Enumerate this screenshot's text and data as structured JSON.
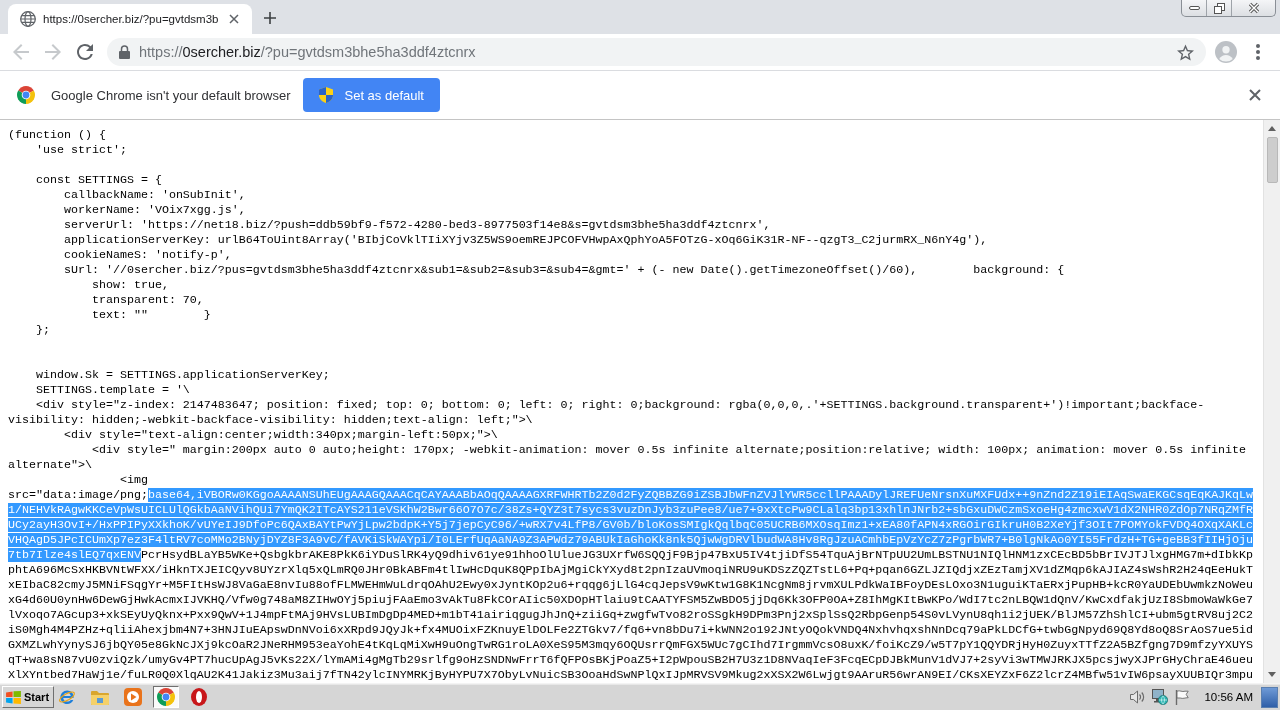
{
  "browser": {
    "tabs": [
      {
        "title": "https://0sercher.biz/?pu=gvtdsm3b",
        "selected": true
      }
    ],
    "nav_buttons": [
      {
        "kind": "back",
        "disabled": true
      },
      {
        "kind": "forward",
        "disabled": true
      },
      {
        "kind": "reload",
        "disabled": false
      }
    ],
    "address_bar": {
      "url": [
        {
          "text": "https://",
          "emphasized": false
        },
        {
          "text": "0sercher.biz",
          "emphasized": true
        },
        {
          "text": "/?pu=gvtdsm3bhe5ha3ddf4ztcnrx",
          "emphasized": false
        }
      ]
    },
    "infobar": {
      "message": "Google Chrome isn't your default browser",
      "button": "Set as default"
    }
  },
  "page": {
    "lines": [
      {
        "kind": "code",
        "segments": [
          {
            "text": "(function () {",
            "selected": false
          }
        ]
      },
      {
        "kind": "code",
        "segments": [
          {
            "text": "    'use strict';",
            "selected": false
          }
        ]
      },
      {
        "kind": "blank"
      },
      {
        "kind": "code",
        "segments": [
          {
            "text": "    const SETTINGS = {",
            "selected": false
          }
        ]
      },
      {
        "kind": "code",
        "segments": [
          {
            "text": "        callbackName: 'onSubInit',",
            "selected": false
          }
        ]
      },
      {
        "kind": "code",
        "segments": [
          {
            "text": "        workerName: 'VOix7xgg.js',",
            "selected": false
          }
        ]
      },
      {
        "kind": "code",
        "segments": [
          {
            "text": "        serverUrl: 'https://net18.biz/?push=ddb59bf9-f572-4280-bed3-8977503f14e8&s=gvtdsm3bhe5ha3ddf4ztcnrx',",
            "selected": false
          }
        ]
      },
      {
        "kind": "code",
        "segments": [
          {
            "text": "        applicationServerKey: urlB64ToUint8Array('BIbjCoVklTIiXYjv3Z5WS9oemREJPCOFVHwpAxQphYoA5FOTzG-xOq6GiK31R-NF--qzgT3_C2jurmRX_N6nY4g'),",
            "selected": false
          }
        ]
      },
      {
        "kind": "code",
        "segments": [
          {
            "text": "        cookieNameS: 'notify-p',",
            "selected": false
          }
        ]
      },
      {
        "kind": "code",
        "segments": [
          {
            "text": "        sUrl: '//0sercher.biz/?pus=gvtdsm3bhe5ha3ddf4ztcnrx&sub1=&sub2=&sub3=&sub4=&gmt=' + (- new Date().getTimezoneOffset()/60),        background: {",
            "selected": false
          }
        ]
      },
      {
        "kind": "code",
        "segments": [
          {
            "text": "            show: true,",
            "selected": false
          }
        ]
      },
      {
        "kind": "code",
        "segments": [
          {
            "text": "            transparent: 70,",
            "selected": false
          }
        ]
      },
      {
        "kind": "code",
        "segments": [
          {
            "text": "            text: \"\"        }",
            "selected": false
          }
        ]
      },
      {
        "kind": "code",
        "segments": [
          {
            "text": "    };",
            "selected": false
          }
        ]
      },
      {
        "kind": "blank"
      },
      {
        "kind": "blank"
      },
      {
        "kind": "code",
        "segments": [
          {
            "text": "    window.Sk = SETTINGS.applicationServerKey;",
            "selected": false
          }
        ]
      },
      {
        "kind": "code",
        "segments": [
          {
            "text": "    SETTINGS.template = '\\",
            "selected": false
          }
        ]
      },
      {
        "kind": "code",
        "segments": [
          {
            "text": "    <div style=\"z-index: 2147483647; position: fixed; top: 0; bottom: 0; left: 0; right: 0;background: rgba(0,0,0,.'+SETTINGS.background.transparent+')!important;backface-",
            "selected": false
          }
        ]
      },
      {
        "kind": "code",
        "segments": [
          {
            "text": "visibility: hidden;-webkit-backface-visibility: hidden;text-align: left;\">\\",
            "selected": false
          }
        ]
      },
      {
        "kind": "code",
        "segments": [
          {
            "text": "        <div style=\"text-align:center;width:340px;margin-left:50px;\">\\",
            "selected": false
          }
        ]
      },
      {
        "kind": "code",
        "segments": [
          {
            "text": "            <div style=\" margin:200px auto 0 auto;height: 170px; -webkit-animation: mover 0.5s infinite alternate;position:relative; width: 100px; animation: mover 0.5s infinite",
            "selected": false
          }
        ]
      },
      {
        "kind": "code",
        "segments": [
          {
            "text": "alternate\">\\",
            "selected": false
          }
        ]
      },
      {
        "kind": "code",
        "segments": [
          {
            "text": "                <img",
            "selected": false
          }
        ]
      },
      {
        "kind": "code",
        "segments": [
          {
            "text": "src=\"data:image/png;",
            "selected": false
          },
          {
            "text": "base64,iVBORw0KGgoAAAANSUhEUgAAAGQAAACqCAYAAABbAOqQAAAAGXRFWHRTb2Z0d2FyZQBBZG9iZSBJbWFnZVJlYWR5ccllPAAADylJREFUeNrsnXuMXFUdx++9nZnd2Z19iEIAqSwaEKGCsqEqKAJKqLw",
            "selected": true
          }
        ]
      },
      {
        "kind": "code",
        "segments": [
          {
            "text": "1/NEHVkRAgwKKCeVpWsUICLUlQGkbAaNVihQUi7YmQK2ITcAYS211eVSKhW2Bwr66O7O7c/38Zs+QYZ3t7sycs3vuzDnJyb3zuPee8/ue7+9xXtcPw9CLalq3bp13xhlnJNrb2+sbGxuDWCzmSxoeHg4zmcxwV1dX2NHR0ZdOp7NRqZMfR",
            "selected": true
          }
        ]
      },
      {
        "kind": "code",
        "segments": [
          {
            "text": "UCy2ayH3OvI+/HxPPIPyXXkhoK/vUYeIJ9DfoPc6QAxBAYtPwYjLpw2bdpK+Y5j7jepCyC96/+wRX7v4LfP8/GV0b/bloKosSMIgkQqlbqC05UCRB6MXOsqImz1+xEA80fAPN4xRGOirGIkruH0B2XeYjf3OIt7POMYokFVDQ4OXqXAKLc",
            "selected": true
          }
        ]
      },
      {
        "kind": "code",
        "segments": [
          {
            "text": "VHQAgD5JPcICUmXp7ez3F4ltRV7coMMo2BNyjDYZ8F3A9vC/fAVKiSkWAYpi/I0LErfUqAaNA9Z3APWdz79ABUkIaGhoKk8nk5QjwWgDRVlbudWA8Hv8RgJzuACmhbEpVzYcZ7zPgrbWR7+B0lgNkAo0YI55FrdzH+TG+geBB3fIIHjOju",
            "selected": true
          }
        ]
      },
      {
        "kind": "code",
        "segments": [
          {
            "text": "7tb7Ilze4slEQ7qxENV",
            "selected": true
          },
          {
            "text": "PcrHsydBLaYB5WKe+QsbgkbrAKE8PkK6iYDuSlRK4yQ9dhiv61ye91hhoOlUlueJG3UXrfW6SQQjF9Bjp47BxU5IV4tjiDfS54TquAjBrNTpUU2UmLBSTNU1NIQlHNM1zxCEcBD5bBrIVJTJlxgHMG7m+dIbkKp",
            "selected": false
          }
        ]
      },
      {
        "kind": "code",
        "segments": [
          {
            "text": "phtA696McSxHKBVNtWFXX/iHknTXJEICQyv8UYzrXlq5xQLmRQ0JHr0BkABFm4tlIwHcDquK8QPpIbAjMgiCkYXyd8t2pnIzaUVmoqiNRU9uKDSzZQZTstL6+Pq+pqan6GZLJZIQdjxZEzTamjXV1dZMqp6kAJIAZ4sWshR2H24qEeHukT",
            "selected": false
          }
        ]
      },
      {
        "kind": "code",
        "segments": [
          {
            "text": "xEIbaC82cmyJ5MNiFSqgYr+M5FItHsWJ8VaGaE8nvIu88ofFLMWEHmWuLdrqOAhU2Ewy0xJyntKOp2u6+rqqg6jLlG4cqJepsV9wKtw1G8K1NcgNm8jrvmXULPdkWaIBFoyDEsLOxo3N1uguiKTaERxjPupHB+kcR0YaUDEbUwmkzNoWeu",
            "selected": false
          }
        ]
      },
      {
        "kind": "code",
        "segments": [
          {
            "text": "xG4d60U0ynHw6DewGjHwkAcmxIJVKHQ/Vfw0g748aM8ZIHwOYj5piujFAaEmo3vAkTu8FkCOrAIic50XDOpHTlaiu9tCAATYFSM5ZwBDO5jjDq6Kk3OFP0OA+Z8IhMgKItBwKPo/WdI7tc2nLBQW1dQnV/KwCxdfakjUzI8SbmoWaWkGe7",
            "selected": false
          }
        ]
      },
      {
        "kind": "code",
        "segments": [
          {
            "text": "lVxoqo7AGcup3+xkSEyUyQknx+Pxx9QwV+1J4mpFtMAj9HVsLUBImDgDp4MED+m1bT41airiqgugJhJnQ+ziiGq+zwgfwTvo82roSSgkH9DPm3Pnj2xSplSsQ2RbpGenp54S0vLVynU8qh1i2jUEK/BlJM57ZhShlCI+ubm5gtRV8uj2C2",
            "selected": false
          }
        ]
      },
      {
        "kind": "code",
        "segments": [
          {
            "text": "iS0Mgh4M4PZHz+qliiAhexjbm4N7+3HNJIuEApswDnNVoi6xXRpd9JQyJk+fx4MUOixFZKnuyElDOLFe2ZTGkv7/fq6+vn8bDu7i+kWNN2o192JNtyOQokVNDQ4NxhvhqxshNnDcq79aPkLDCfG+twbGgNpyd69Q8Yd8oQ8SrAoS7ue5id",
            "selected": false
          }
        ]
      },
      {
        "kind": "code",
        "segments": [
          {
            "text": "GXMZLwhYynySJ6jbQY05e8GkNcJXj9kcOaR2JNeRHM953eaYohE4tKqLqMiXwH9uOngTwRG1roLA0XeS95M3mqy6OQUsrrQmFGX5WUc7gCIhd7IrgmmVcsO8uxK/foiKcZ9/w5T7pY1QQYDRjHyH0ZuyxTTfZ2A5BZfgng7D9mfzyYXUYS",
            "selected": false
          }
        ]
      },
      {
        "kind": "code",
        "segments": [
          {
            "text": "qT+wa8sN87vU0zviQzk/umyGv4PT7hucUpAgJ5vKs22X/lYmAMi4gMgTb29srlfg9oHzSNDNwFrrT6fQFPOsBKjPoaZ5+I2pWpouSB2H7U3z1D8NVaqIeF3FcqECpDJBkMunV1dVJ7+2syVi3wTMWJRKJX5pcsjwyXJPrGHyChraE46ueu",
            "selected": false
          }
        ]
      },
      {
        "kind": "code",
        "segments": [
          {
            "text": "XlXYntbed7HaWj1e/fuLR0Q0XlqAU2K41Jakiz3Mu3aij7fTN42ylcINYMRKjByHYPU7X7ObyLvNuicSB3OoaHdSwNPlQxIJpMRVSV9Mkug2xXSX2W6Lwjgt9AAruR56wrAN9EI/CKsXEYZxF6Z2lcrZ4MBfw51vIW6psayXUUBIQr3mpu",
            "selected": false
          }
        ]
      }
    ]
  },
  "taskbar": {
    "start": "Start",
    "apps": [
      {
        "kind": "e-logo",
        "selected": false
      },
      {
        "kind": "folder",
        "selected": false
      },
      {
        "kind": "media",
        "selected": false
      },
      {
        "kind": "browser",
        "selected": true
      },
      {
        "kind": "ring",
        "selected": false
      }
    ],
    "tray": [
      {
        "kind": "volume"
      },
      {
        "kind": "network"
      },
      {
        "kind": "flag"
      }
    ],
    "clock": "10:56 AM"
  }
}
